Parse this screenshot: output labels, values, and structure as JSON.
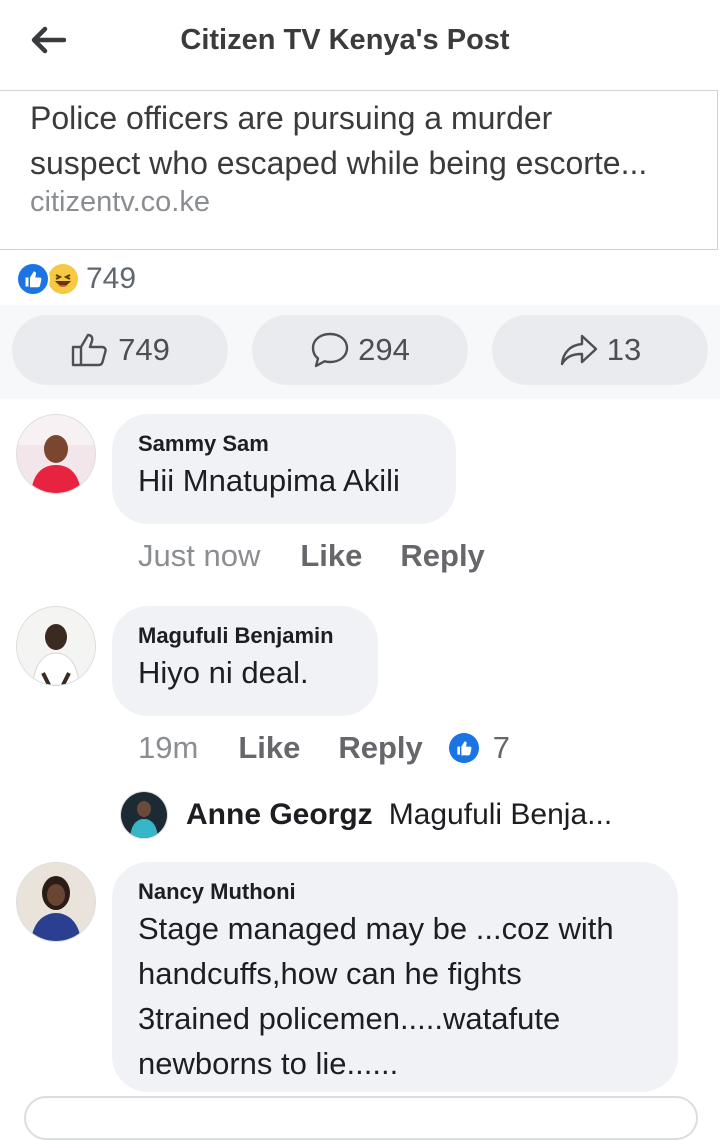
{
  "header": {
    "title": "Citizen TV Kenya's Post"
  },
  "link_card": {
    "text_line1": "Police officers are pursuing a murder",
    "text_line2": "suspect who escaped while being escorte...",
    "domain": "citizentv.co.ke"
  },
  "reactions_summary": {
    "count": "749",
    "icons": [
      "like-icon",
      "haha-icon"
    ]
  },
  "actions": {
    "like": {
      "count": "749",
      "icon": "thumbs-up-icon"
    },
    "comment": {
      "count": "294",
      "icon": "comment-icon"
    },
    "share": {
      "count": "13",
      "icon": "share-icon"
    }
  },
  "comments": [
    {
      "author": "Sammy Sam",
      "text": "Hii Mnatupima Akili",
      "time": "Just now",
      "like_label": "Like",
      "reply_label": "Reply"
    },
    {
      "author": "Magufuli Benjamin",
      "text": "Hiyo ni deal.",
      "time": "19m",
      "like_label": "Like",
      "reply_label": "Reply",
      "likes": "7",
      "reply_preview": {
        "author": "Anne Georgz",
        "text": "Magufuli Benja..."
      }
    },
    {
      "author": "Nancy Muthoni",
      "text_lines": [
        "Stage managed may be ...coz with",
        "handcuffs,how can he fights",
        "3trained policemen.....watafute",
        "newborns to lie......"
      ]
    }
  ],
  "colors": {
    "accent": "#1b74e4",
    "bubble": "#f0f2f5",
    "action_bg": "#f7f8fa"
  }
}
